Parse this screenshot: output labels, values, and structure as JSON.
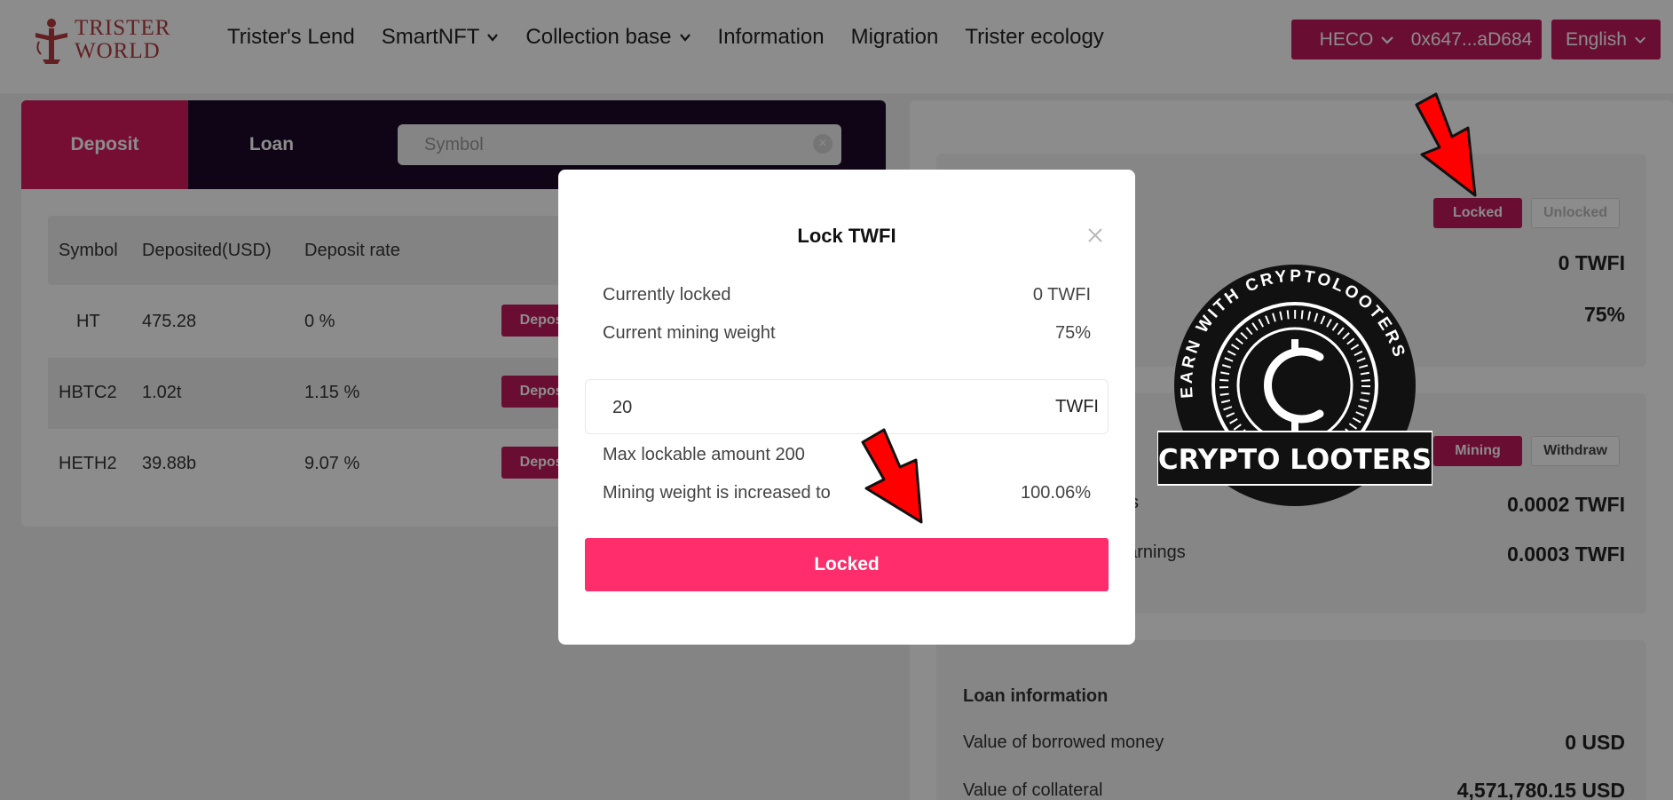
{
  "header": {
    "logo_lines": [
      "TRISTER",
      "WORLD"
    ],
    "nav": [
      {
        "label": "Trister's Lend",
        "dropdown": false
      },
      {
        "label": "SmartNFT",
        "dropdown": true
      },
      {
        "label": "Collection base",
        "dropdown": true
      },
      {
        "label": "Information",
        "dropdown": false
      },
      {
        "label": "Migration",
        "dropdown": false
      },
      {
        "label": "Trister ecology",
        "dropdown": false
      }
    ],
    "network": "HECO",
    "wallet": "0x647...aD684",
    "language": "English"
  },
  "left_panel": {
    "tabs": [
      "Deposit",
      "Loan"
    ],
    "search_placeholder": "Symbol",
    "columns": [
      "Symbol",
      "Deposited(USD)",
      "Deposit rate"
    ],
    "rows": [
      {
        "symbol": "HT",
        "deposited": "475.28",
        "rate": "0 %",
        "action": "Deposit"
      },
      {
        "symbol": "HBTC2",
        "deposited": "1.02t",
        "rate": "1.15 %",
        "action": "Deposit"
      },
      {
        "symbol": "HETH2",
        "deposited": "39.88b",
        "rate": "9.07 %",
        "action": "Deposit"
      }
    ]
  },
  "right_panel": {
    "lock_card": {
      "locked_btn": "Locked",
      "unlocked_btn": "Unlocked",
      "locked_value": "0 TWFI",
      "weight_value": "75%"
    },
    "mining_card": {
      "mining_btn": "Mining",
      "withdraw_btn": "Withdraw",
      "row1_label_tail": "s",
      "row1_value": "0.0002 TWFI",
      "row2_label_tail": "earnings",
      "row2_value": "0.0003 TWFI"
    },
    "loan_card": {
      "title": "Loan information",
      "rows": [
        {
          "label": "Value of borrowed money",
          "value": "0 USD"
        },
        {
          "label": "Value of collateral",
          "value": "4,571,780.15 USD"
        }
      ]
    }
  },
  "modal": {
    "title": "Lock TWFI",
    "currently_locked_label": "Currently locked",
    "currently_locked_value": "0 TWFI",
    "current_weight_label": "Current mining weight",
    "current_weight_value": "75%",
    "amount_value": "20",
    "amount_unit": "TWFI",
    "max_lockable": "Max lockable amount 200",
    "increased_label": "Mining weight is increased to",
    "increased_value": "100.06%",
    "submit_label": "Locked"
  },
  "watermark": {
    "ring_text": "EARN WITH CRYPTOLOOTERS",
    "banner": "CRYPTO LOOTERS"
  },
  "colors": {
    "accent": "#c2185b",
    "primary_button": "#ff2d6b",
    "dark_header": "#1c0a2a",
    "arrow": "#ff0000"
  }
}
